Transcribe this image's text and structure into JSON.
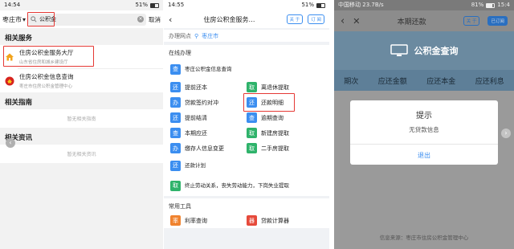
{
  "screen1": {
    "status": {
      "time": "14:54",
      "battery": "51%"
    },
    "city": "枣庄市",
    "search_value": "公积金",
    "cancel": "取消",
    "sections": {
      "services": "相关服务",
      "guide": "相关指南",
      "news": "相关资讯"
    },
    "services": [
      {
        "title": "住房公积金服务大厅",
        "subtitle": "山东省住房和城乡建设厅"
      },
      {
        "title": "住房公积金信息查询",
        "subtitle": "枣庄市住房公积金管理中心"
      }
    ],
    "no_guide": "暂无相关指南",
    "no_news": "暂无相关资讯"
  },
  "screen2": {
    "status": {
      "time": "14:55",
      "battery": "51%"
    },
    "title": "住房公积金服务…",
    "follow": "关 于",
    "subscribe": "订 阅",
    "network_label": "办理网点",
    "network_city": "枣庄市",
    "online_title": "在线办理",
    "items": [
      {
        "icon": "查",
        "color": "#3b8ef0",
        "label": "枣庄公积金信息查询",
        "full": true
      },
      {
        "icon": "还",
        "color": "#3b8ef0",
        "label": "提前还本"
      },
      {
        "icon": "取",
        "color": "#2fb36b",
        "label": "离退休提取"
      },
      {
        "icon": "办",
        "color": "#3b8ef0",
        "label": "贷款签约对冲"
      },
      {
        "icon": "还",
        "color": "#3b8ef0",
        "label": "还款明细"
      },
      {
        "icon": "还",
        "color": "#3b8ef0",
        "label": "提前结清"
      },
      {
        "icon": "查",
        "color": "#3b8ef0",
        "label": "逾期查询"
      },
      {
        "icon": "查",
        "color": "#3b8ef0",
        "label": "本期应还"
      },
      {
        "icon": "取",
        "color": "#2fb36b",
        "label": "新建房提取"
      },
      {
        "icon": "办",
        "color": "#3b8ef0",
        "label": "缴存人信息变更"
      },
      {
        "icon": "取",
        "color": "#2fb36b",
        "label": "二手房提取"
      },
      {
        "icon": "还",
        "color": "#3b8ef0",
        "label": "还款计划",
        "full": true
      },
      {
        "icon": "取",
        "color": "#2fb36b",
        "label": "终止劳动关系，丧失劳动能力，下岗失业提取",
        "full": true
      }
    ],
    "tools_title": "常用工具",
    "tools": [
      {
        "icon": "率",
        "color": "#f0832f",
        "label": "利率查询"
      },
      {
        "icon": "器",
        "color": "#e64a3b",
        "label": "贷款计算器"
      }
    ]
  },
  "screen3": {
    "status": {
      "carrier": "中国移动",
      "speed": "23.7B/s",
      "battery": "81%",
      "time": "15:4"
    },
    "title": "本期还款",
    "follow": "关 于",
    "subscribe": "已订阅",
    "banner": "公积金查询",
    "columns": [
      "期次",
      "应还金额",
      "应还本金",
      "应还利息"
    ],
    "dialog": {
      "title": "提示",
      "message": "无贷款信息",
      "button": "退出"
    },
    "footer": "信息来源：枣庄市住房公积金管理中心"
  }
}
